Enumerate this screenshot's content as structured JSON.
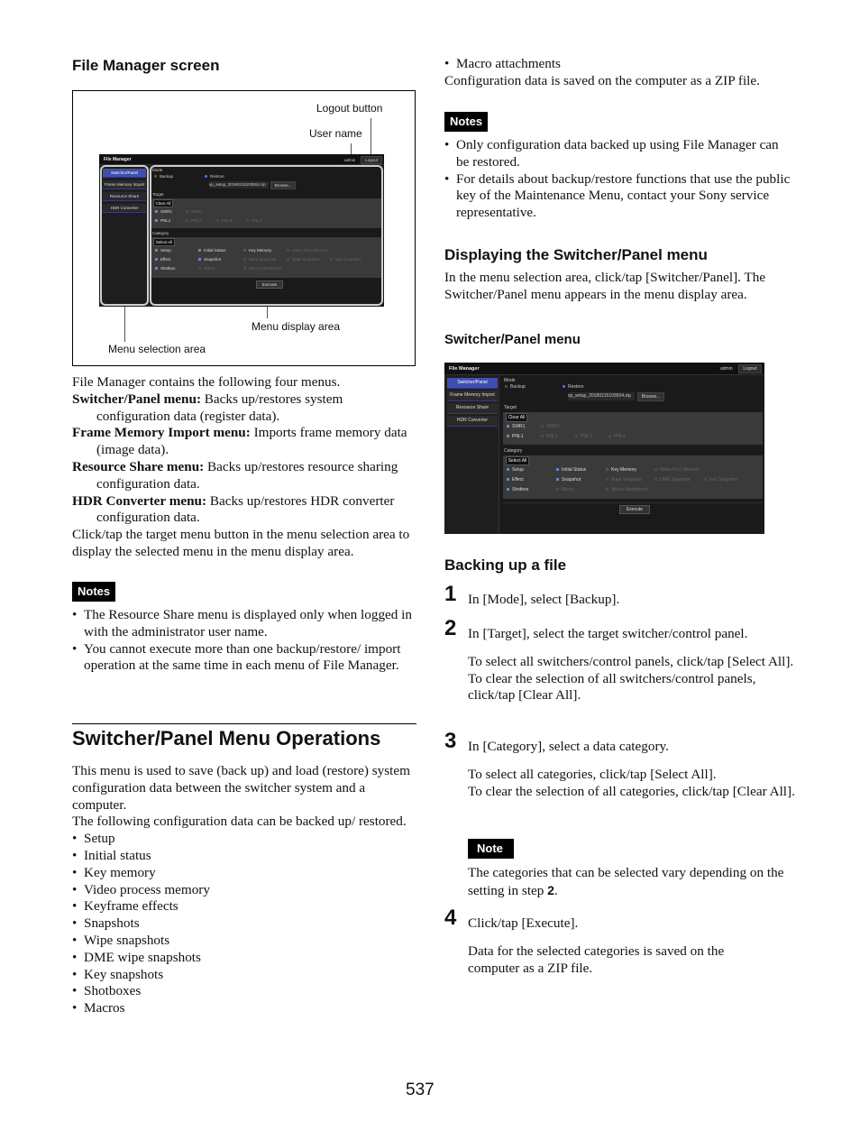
{
  "left": {
    "section_title": "File Manager screen",
    "figure": {
      "callouts": {
        "logout_button": "Logout button",
        "user_name": "User name",
        "menu_display_area": "Menu display area",
        "menu_selection_area": "Menu selection area"
      }
    },
    "intro": "File Manager contains the following four menus.",
    "menus": [
      {
        "term": "Switcher/Panel menu:",
        "desc": " Backs up/restores system configuration data (register data)."
      },
      {
        "term": "Frame Memory Import menu:",
        "desc": " Imports frame memory data (image data)."
      },
      {
        "term": "Resource Share menu:",
        "desc": " Backs up/restores resource sharing configuration data."
      },
      {
        "term": "HDR Converter menu:",
        "desc": " Backs up/restores HDR converter configuration data."
      }
    ],
    "click_text": "Click/tap the target menu button in the menu selection area to display the selected menu in the menu display area.",
    "notes_label": "Notes",
    "notes": [
      "The Resource Share menu is displayed only when logged in with the administrator user name.",
      "You cannot execute more than one backup/restore/ import operation at the same time in each menu of File Manager."
    ],
    "ops_heading": "Switcher/Panel Menu Operations",
    "ops_para1": "This menu is used to save (back up) and load (restore) system configuration data between the switcher system and a computer.",
    "ops_para2": "The following configuration data can be backed up/ restored.",
    "data_items": [
      "Setup",
      "Initial status",
      "Key memory",
      "Video process memory",
      "Keyframe effects",
      "Snapshots",
      "Wipe snapshots",
      "DME wipe snapshots",
      "Key snapshots",
      "Shotboxes",
      "Macros"
    ]
  },
  "right": {
    "data_item_cont": "Macro attachments",
    "zip_text": "Configuration data is saved on the computer as a ZIP file.",
    "notes_label": "Notes",
    "notes": [
      "Only configuration data backed up using File Manager can be restored.",
      "For details about backup/restore functions that use the public key of the Maintenance Menu, contact your Sony service representative."
    ],
    "display_heading": "Displaying the Switcher/Panel menu",
    "display_para": "In the menu selection area, click/tap [Switcher/Panel]. The Switcher/Panel menu appears in the menu display area.",
    "menu_subheading": "Switcher/Panel menu",
    "backup_heading": "Backing up a file",
    "steps": [
      {
        "num": "1",
        "text": "In [Mode], select [Backup].",
        "extra": []
      },
      {
        "num": "2",
        "text": "In [Target], select the target switcher/control panel.",
        "extra": [
          "To select all switchers/control panels, click/tap [Select All].",
          "To clear the selection of all switchers/control panels, click/tap [Clear All]."
        ]
      },
      {
        "num": "3",
        "text": "In [Category], select a data category.",
        "extra": [
          "To select all categories, click/tap [Select All].",
          "To clear the selection of all categories, click/tap [Clear All]."
        ]
      },
      {
        "num": "4",
        "text": "Click/tap [Execute].",
        "extra": [
          "Data for the selected categories is saved on the computer as a ZIP file."
        ]
      }
    ],
    "note_label": "Note",
    "note_text_pre": "The categories that can be selected vary depending on the setting in step ",
    "note_text_bold": "2",
    "note_text_post": "."
  },
  "ui": {
    "app_title": "File Manager",
    "user": "admin",
    "logout": "Logout",
    "menu_buttons": [
      "Switcher/Panel",
      "Frame Memory Import",
      "Resource Share",
      "HDR Converter"
    ],
    "mode_label": "Mode",
    "mode_options": [
      {
        "label": "Backup",
        "selected": false
      },
      {
        "label": "Restore",
        "selected": true
      }
    ],
    "file_name": "sp_setup_20180215103504.zip",
    "browse": "Browse...",
    "target_label": "Target",
    "clear_all": "Clear All",
    "targets": [
      {
        "label": "SWR1",
        "checked": true,
        "enabled": true
      },
      {
        "label": "SWR2",
        "checked": false,
        "enabled": false
      },
      {
        "label": "PNL1",
        "checked": true,
        "enabled": true
      },
      {
        "label": "PNL2",
        "checked": false,
        "enabled": false
      },
      {
        "label": "PNL3",
        "checked": false,
        "enabled": false
      },
      {
        "label": "PNL4",
        "checked": false,
        "enabled": false
      }
    ],
    "category_label": "Category",
    "select_all": "Select All",
    "categories": [
      {
        "label": "Setup",
        "checked": true,
        "enabled": true
      },
      {
        "label": "Initial Status",
        "checked": true,
        "enabled": true
      },
      {
        "label": "Key Memory",
        "checked": false,
        "enabled": true
      },
      {
        "label": "Video Proc Memory",
        "checked": false,
        "enabled": false
      },
      {
        "label": "Effect",
        "checked": true,
        "enabled": true
      },
      {
        "label": "Snapshot",
        "checked": true,
        "enabled": true
      },
      {
        "label": "Wipe Snapshot",
        "checked": false,
        "enabled": false
      },
      {
        "label": "DME Snapshot",
        "checked": false,
        "enabled": false
      },
      {
        "label": "Key Snapshot",
        "checked": false,
        "enabled": false
      },
      {
        "label": "Shotbox",
        "checked": true,
        "enabled": true
      },
      {
        "label": "Macro",
        "checked": false,
        "enabled": false
      },
      {
        "label": "Macro Attachment",
        "checked": false,
        "enabled": false
      }
    ],
    "execute": "Execute"
  },
  "page_number": "537"
}
